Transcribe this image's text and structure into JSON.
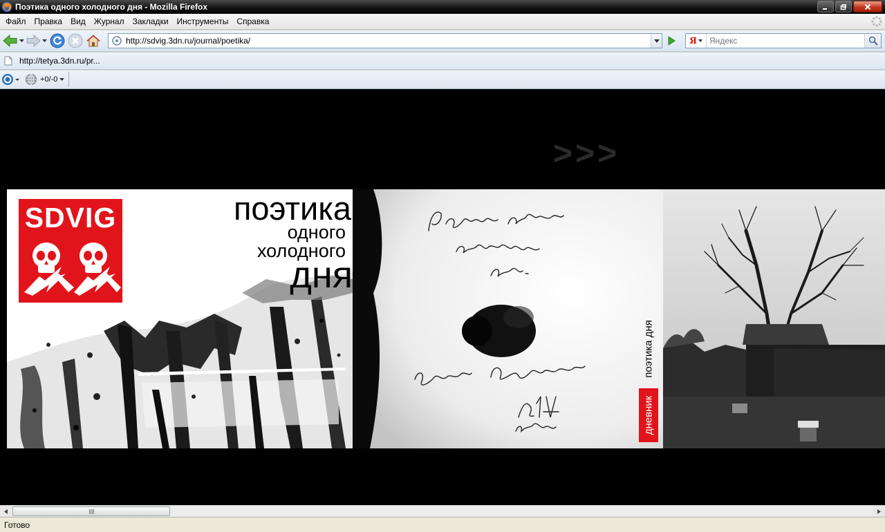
{
  "window": {
    "title": "Поэтика одного холодного дня - Mozilla Firefox"
  },
  "menu": {
    "items": [
      {
        "label": "Файл"
      },
      {
        "label": "Правка"
      },
      {
        "label": "Вид"
      },
      {
        "label": "Журнал"
      },
      {
        "label": "Закладки"
      },
      {
        "label": "Инструменты"
      },
      {
        "label": "Справка"
      }
    ]
  },
  "nav": {
    "url": "http://sdvig.3dn.ru/journal/poetika/",
    "search_engine_letter": "Я",
    "search_placeholder": "Яндекс"
  },
  "bookmarks": {
    "items": [
      {
        "label": "http://tetya.3dn.ru/pr..."
      }
    ]
  },
  "extension": {
    "counter": "+0/-0"
  },
  "page": {
    "arrows": ">>>",
    "logo_text": "SDVIG",
    "title_line1": "поэтика",
    "title_line2": "одного",
    "title_line3": "холодного",
    "title_line4": "дня",
    "vertical_label_red": "дневник",
    "vertical_label_black": "поэтика дня",
    "handwriting_line1": "Поэтика одного",
    "handwriting_line2": "холодного",
    "handwriting_line3": "дня.",
    "handwriting_signature": "Евгений Левченко",
    "handwriting_date_1": "20/IV",
    "handwriting_date_2": "2009",
    "accent_red": "#e2141b"
  },
  "status": {
    "text": "Готово"
  }
}
